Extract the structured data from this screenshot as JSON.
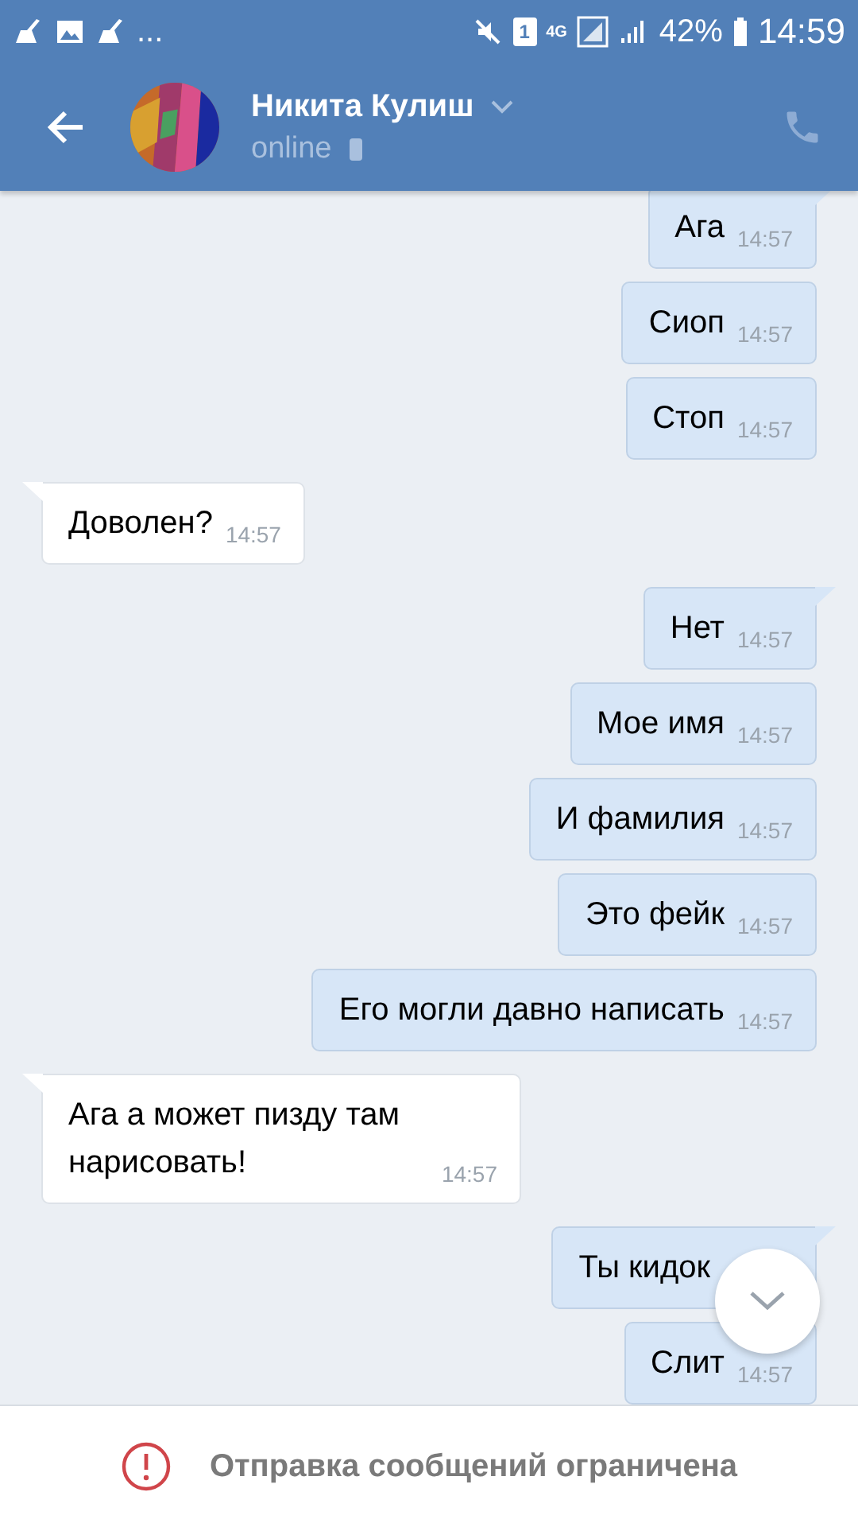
{
  "status_bar": {
    "more": "...",
    "sim": "1",
    "network": "4G",
    "battery": "42%",
    "time": "14:59"
  },
  "header": {
    "name": "Никита Кулиш",
    "status": "online"
  },
  "messages": [
    {
      "kind": "out",
      "text": "Ага",
      "time": "14:57",
      "tail": true
    },
    {
      "kind": "out",
      "text": "Сиоп",
      "time": "14:57",
      "tail": false
    },
    {
      "kind": "out",
      "text": "Стоп",
      "time": "14:57",
      "tail": false
    },
    {
      "kind": "in",
      "text": "Доволен?",
      "time": "14:57",
      "tail": true
    },
    {
      "kind": "out",
      "text": "Нет",
      "time": "14:57",
      "tail": true
    },
    {
      "kind": "out",
      "text": "Мое имя",
      "time": "14:57",
      "tail": false
    },
    {
      "kind": "out",
      "text": "И фамилия",
      "time": "14:57",
      "tail": false
    },
    {
      "kind": "out",
      "text": "Это фейк",
      "time": "14:57",
      "tail": false
    },
    {
      "kind": "out",
      "text": "Его могли давно написать",
      "time": "14:57",
      "tail": false
    },
    {
      "kind": "in",
      "text": "Ага а может пизду там нарисовать!",
      "time": "14:57",
      "tail": true
    },
    {
      "kind": "out",
      "text": "Ты кидок",
      "tail": true
    },
    {
      "kind": "out",
      "text": "Слит",
      "time": "14:57",
      "tail": false
    }
  ],
  "footer": {
    "notice": "Отправка сообщений ограничена"
  }
}
